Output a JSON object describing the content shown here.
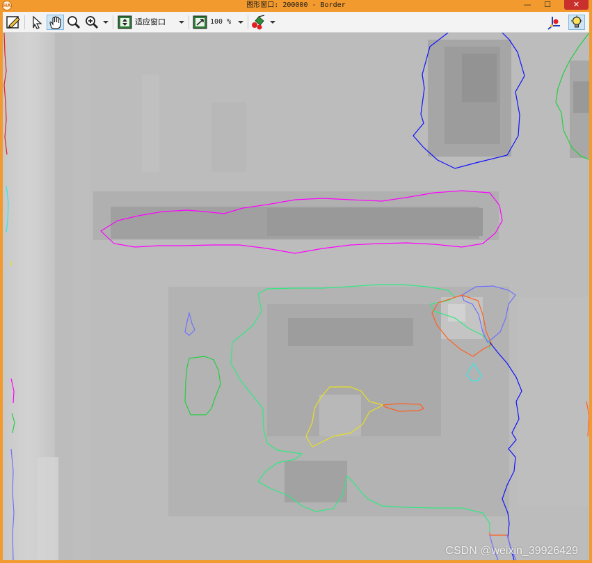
{
  "window": {
    "title": "图形窗口: 200000 - Border",
    "app_badge": "HA",
    "controls": {
      "minimize": "—",
      "maximize": "☐",
      "close": "✕"
    }
  },
  "toolbar": {
    "fit_label": "适应窗口",
    "zoom_label": "100 %"
  },
  "colors": {
    "frame": "#f29a2e",
    "toolbar_bg": "#f3f3f3",
    "magenta": "#ff00ff",
    "green": "#20d040",
    "mint": "#30e880",
    "blue": "#1010ff",
    "slate": "#7070ff",
    "yellow": "#e8e020",
    "orange": "#ff6020",
    "cyan": "#30e8e8",
    "red": "#e02020"
  },
  "image": {
    "watermark": "CSDN @weixin_39926429"
  }
}
